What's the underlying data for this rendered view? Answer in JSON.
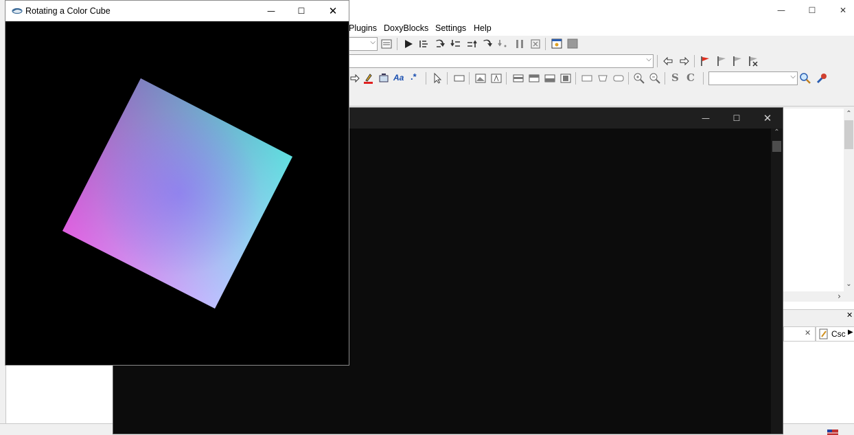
{
  "gl_window": {
    "title": "Rotating a Color Cube",
    "icon": "app-icon",
    "controls": {
      "minimize": "—",
      "maximize": "☐",
      "close": "✕"
    }
  },
  "ide": {
    "menu": [
      "Plugins",
      "DoxyBlocks",
      "Settings",
      "Help"
    ],
    "window_controls": {
      "minimize": "—",
      "maximize": "☐",
      "close": "✕"
    },
    "toolbar_text": {
      "italic_s": "S",
      "italic_c": "C",
      "aa": "Aa",
      "regex": ".*"
    },
    "combo_arrow": "⌵",
    "right_tab_label": "Csc",
    "right_tab_close": "✕",
    "pane_close": "✕",
    "scroll_up": "⌃",
    "scroll_down": "⌄",
    "scroll_right": "›",
    "tab_scroll_right": "▶"
  },
  "console": {
    "controls": {
      "minimize": "—",
      "maximize": "☐",
      "close": "✕"
    },
    "scroll_up": "⌃"
  },
  "colors": {
    "cube_top": "#808080",
    "cube_right": "#00ffff",
    "cube_bottom": "#ffffff",
    "cube_left": "#ff00ff",
    "cube_center": "#8060ff"
  }
}
